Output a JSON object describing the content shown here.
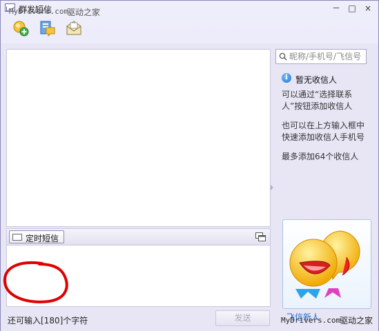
{
  "window": {
    "title": "群发短信",
    "min_label": "－",
    "max_label": "□",
    "close_label": "×"
  },
  "watermark": {
    "latin": "MyDrivers.com",
    "chinese": "驱动之家"
  },
  "toolbar": {
    "icons": [
      "add-contact-icon",
      "message-bubble-icon",
      "envelope-icon"
    ]
  },
  "compose": {
    "scheduled_sms_label": "定时短信",
    "remaining_chars": "还可输入[180]个字符",
    "send_label": "发送"
  },
  "sidebar": {
    "search_placeholder": "昵称/手机号/飞信号",
    "no_recipient_title": "暂无收信人",
    "hint_1": "可以通过“选择联系人”按钮添加收信人",
    "hint_2": "也可以在上方输入框中快速添加收信人手机号",
    "hint_3": "最多添加64个收信人",
    "promo_label": "飞信新人"
  },
  "colors": {
    "accent": "#1b6fc8",
    "annotation": "#e00000",
    "background": "#e8e6f5"
  }
}
